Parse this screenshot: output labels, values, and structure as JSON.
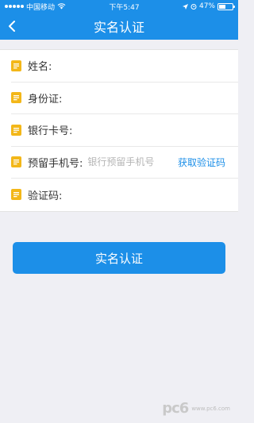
{
  "status_bar": {
    "carrier": "中国移动",
    "time": "下午5:47",
    "battery_percent": "47%",
    "battery_level": 0.47
  },
  "nav": {
    "title": "实名认证"
  },
  "form": {
    "name_label": "姓名:",
    "id_label": "身份证:",
    "card_label": "银行卡号:",
    "phone_label": "预留手机号:",
    "phone_placeholder": "银行预留手机号",
    "get_code_label": "获取验证码",
    "code_label": "验证码:"
  },
  "submit_label": "实名认证",
  "watermark": {
    "logo": "pc6",
    "site": "www.pc6.com"
  },
  "colors": {
    "accent": "#1c8fe8",
    "icon": "#f3b719"
  }
}
